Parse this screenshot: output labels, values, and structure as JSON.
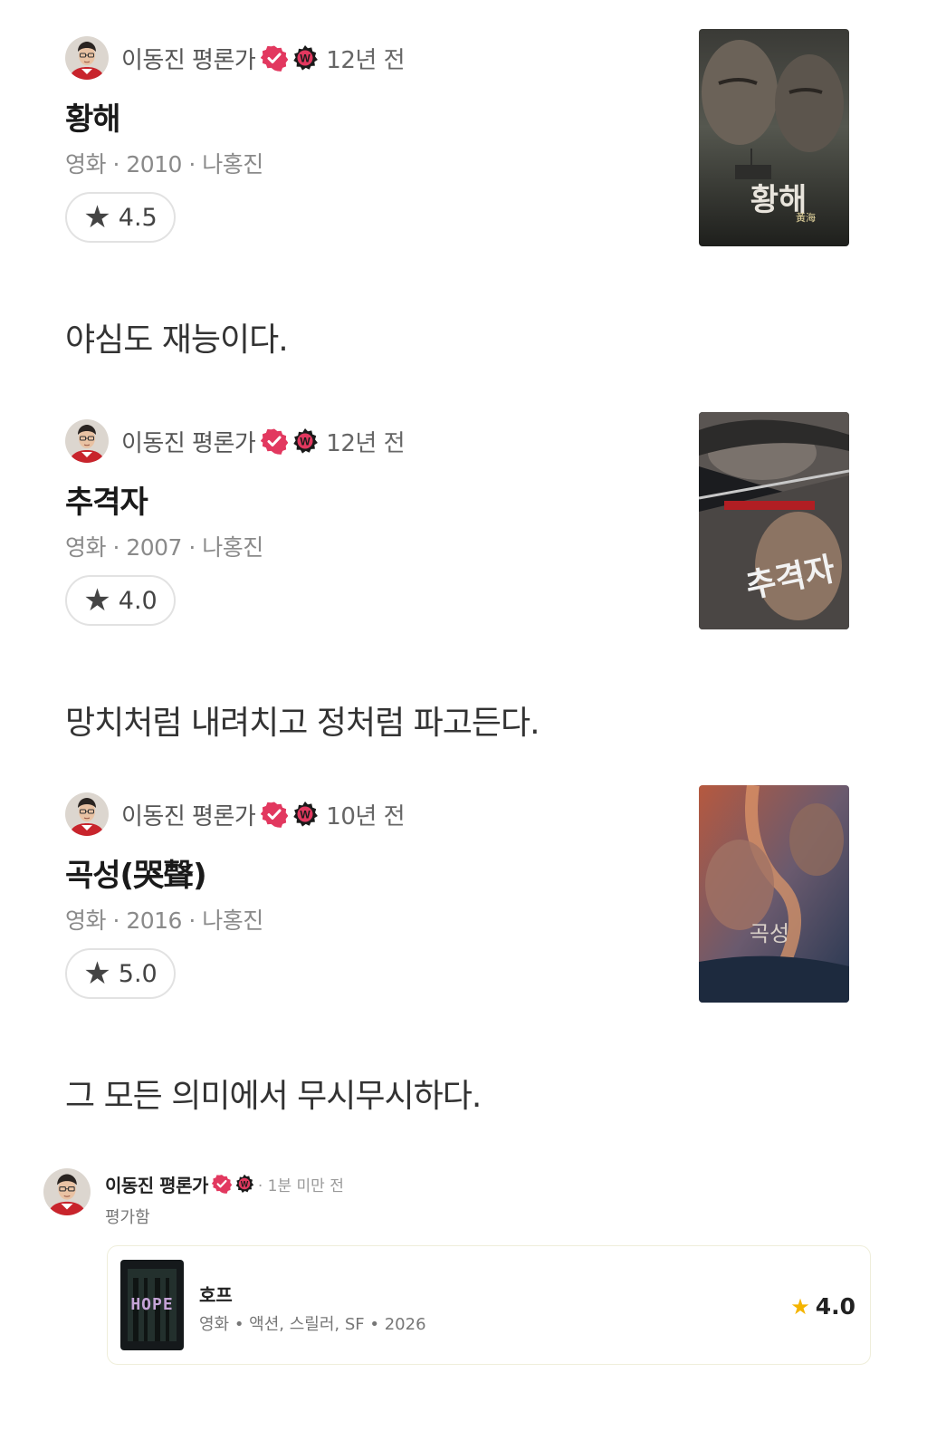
{
  "colors": {
    "badge_pink": "#e2385f",
    "star_gold": "#f4b400",
    "w_badge": "#1a1a1a"
  },
  "reviews": [
    {
      "author": "이동진 평론가",
      "time": "12년 전",
      "title": "황해",
      "meta": "영화 · 2010 · 나홍진",
      "rating": "4.5",
      "quote": "야심도 재능이다.",
      "poster_title": "황해",
      "poster_subtitle": "黃海"
    },
    {
      "author": "이동진 평론가",
      "time": "12년 전",
      "title": "추격자",
      "meta": "영화 · 2007 · 나홍진",
      "rating": "4.0",
      "quote": "망치처럼 내려치고 정처럼 파고든다.",
      "poster_title": "추격자"
    },
    {
      "author": "이동진 평론가",
      "time": "10년 전",
      "title": "곡성(哭聲)",
      "meta": "영화 · 2016 · 나홍진",
      "rating": "5.0",
      "quote": "그 모든 의미에서 무시무시하다.",
      "poster_title": "곡성"
    }
  ],
  "feed": {
    "author": "이동진 평론가",
    "time": "· 1분 미만 전",
    "action": "평가함",
    "movie": {
      "title": "호프",
      "meta": "영화 • 액션, 스릴러, SF • 2026",
      "rating": "4.0",
      "poster_text": "HOPE"
    }
  },
  "icons": {
    "check": "verified-check-icon",
    "w": "watcha-w-badge-icon",
    "star": "star-icon"
  }
}
